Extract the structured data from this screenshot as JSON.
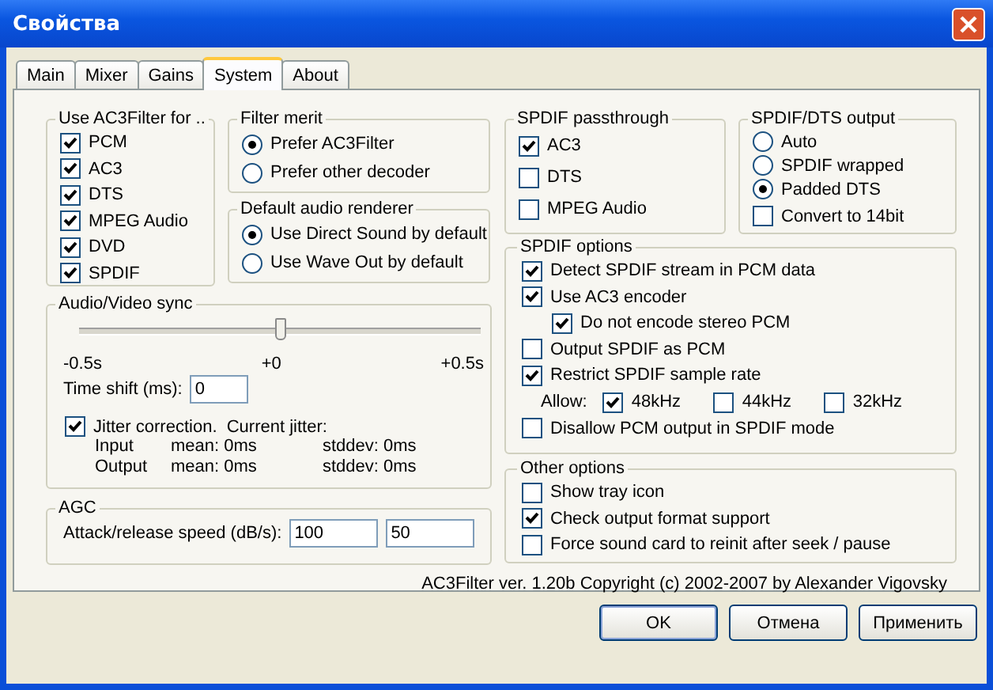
{
  "window": {
    "title": "Свойства"
  },
  "tabs": [
    {
      "label": "Main",
      "selected": false
    },
    {
      "label": "Mixer",
      "selected": false
    },
    {
      "label": "Gains",
      "selected": false
    },
    {
      "label": "System",
      "selected": true
    },
    {
      "label": "About",
      "selected": false
    }
  ],
  "use_ac3filter_for": {
    "title": "Use AC3Filter for ..",
    "items": [
      {
        "label": "PCM",
        "checked": true
      },
      {
        "label": "AC3",
        "checked": true
      },
      {
        "label": "DTS",
        "checked": true
      },
      {
        "label": "MPEG Audio",
        "checked": true
      },
      {
        "label": "DVD",
        "checked": true
      },
      {
        "label": "SPDIF",
        "checked": true
      }
    ]
  },
  "filter_merit": {
    "title": "Filter merit",
    "options": [
      {
        "label": "Prefer AC3Filter",
        "selected": true
      },
      {
        "label": "Prefer other decoder",
        "selected": false
      }
    ]
  },
  "default_audio_renderer": {
    "title": "Default audio renderer",
    "options": [
      {
        "label": "Use Direct Sound by default",
        "selected": true
      },
      {
        "label": "Use Wave Out by default",
        "selected": false
      }
    ]
  },
  "audio_video_sync": {
    "title": "Audio/Video sync",
    "level": 0.5,
    "scale": [
      "-0.5s",
      "+0",
      "+0.5s"
    ],
    "time_shift": {
      "label": "Time shift (ms):",
      "value": "0"
    },
    "jitter": {
      "label": "Jitter correction.  Current jitter:",
      "checked": true
    },
    "stats": [
      [
        "Input",
        "mean: 0ms",
        "stddev: 0ms"
      ],
      [
        "Output",
        "mean: 0ms",
        "stddev: 0ms"
      ]
    ]
  },
  "agc": {
    "title": "AGC",
    "label": "Attack/release speed (dB/s):",
    "values": [
      "100",
      "50"
    ]
  },
  "spdif_passthrough": {
    "title": "SPDIF passthrough",
    "items": [
      {
        "label": "AC3",
        "checked": true
      },
      {
        "label": "DTS",
        "checked": false
      },
      {
        "label": "MPEG Audio",
        "checked": false
      }
    ]
  },
  "spdif_dts_output": {
    "title": "SPDIF/DTS output",
    "options": [
      {
        "label": "Auto",
        "selected": false
      },
      {
        "label": "SPDIF wrapped",
        "selected": false
      },
      {
        "label": "Padded DTS",
        "selected": true
      }
    ],
    "convert": {
      "label": "Convert to 14bit",
      "checked": false
    }
  },
  "spdif_options": {
    "title": "SPDIF options",
    "items": [
      {
        "kind": "checkbox",
        "label": "Detect SPDIF stream in PCM data",
        "checked": true
      },
      {
        "kind": "checkbox",
        "label": "Use AC3 encoder",
        "checked": true,
        "children": [
          {
            "label": "Do not encode stereo PCM",
            "checked": true
          }
        ]
      },
      {
        "kind": "checkbox",
        "label": "Output SPDIF as PCM",
        "checked": false
      },
      {
        "kind": "checkbox",
        "label": "Restrict SPDIF sample rate",
        "checked": true
      },
      {
        "kind": "rates",
        "label": "Allow:",
        "rates": [
          {
            "label": "48kHz",
            "checked": true
          },
          {
            "label": "44kHz",
            "checked": false
          },
          {
            "label": "32kHz",
            "checked": false
          }
        ]
      },
      {
        "kind": "checkbox",
        "label": "Disallow PCM output in SPDIF mode",
        "checked": false
      }
    ]
  },
  "other_options": {
    "title": "Other options",
    "items": [
      {
        "label": "Show tray icon",
        "checked": false
      },
      {
        "label": "Check output format support",
        "checked": true
      },
      {
        "label": "Force sound card to reinit after seek / pause",
        "checked": false
      }
    ]
  },
  "copyright": "AC3Filter ver. 1.20b Copyright (c) 2002-2007 by Alexander Vigovsky",
  "buttons": [
    {
      "label": "OK",
      "default": true
    },
    {
      "label": "Отмена",
      "default": false
    },
    {
      "label": "Применить",
      "default": false
    }
  ]
}
